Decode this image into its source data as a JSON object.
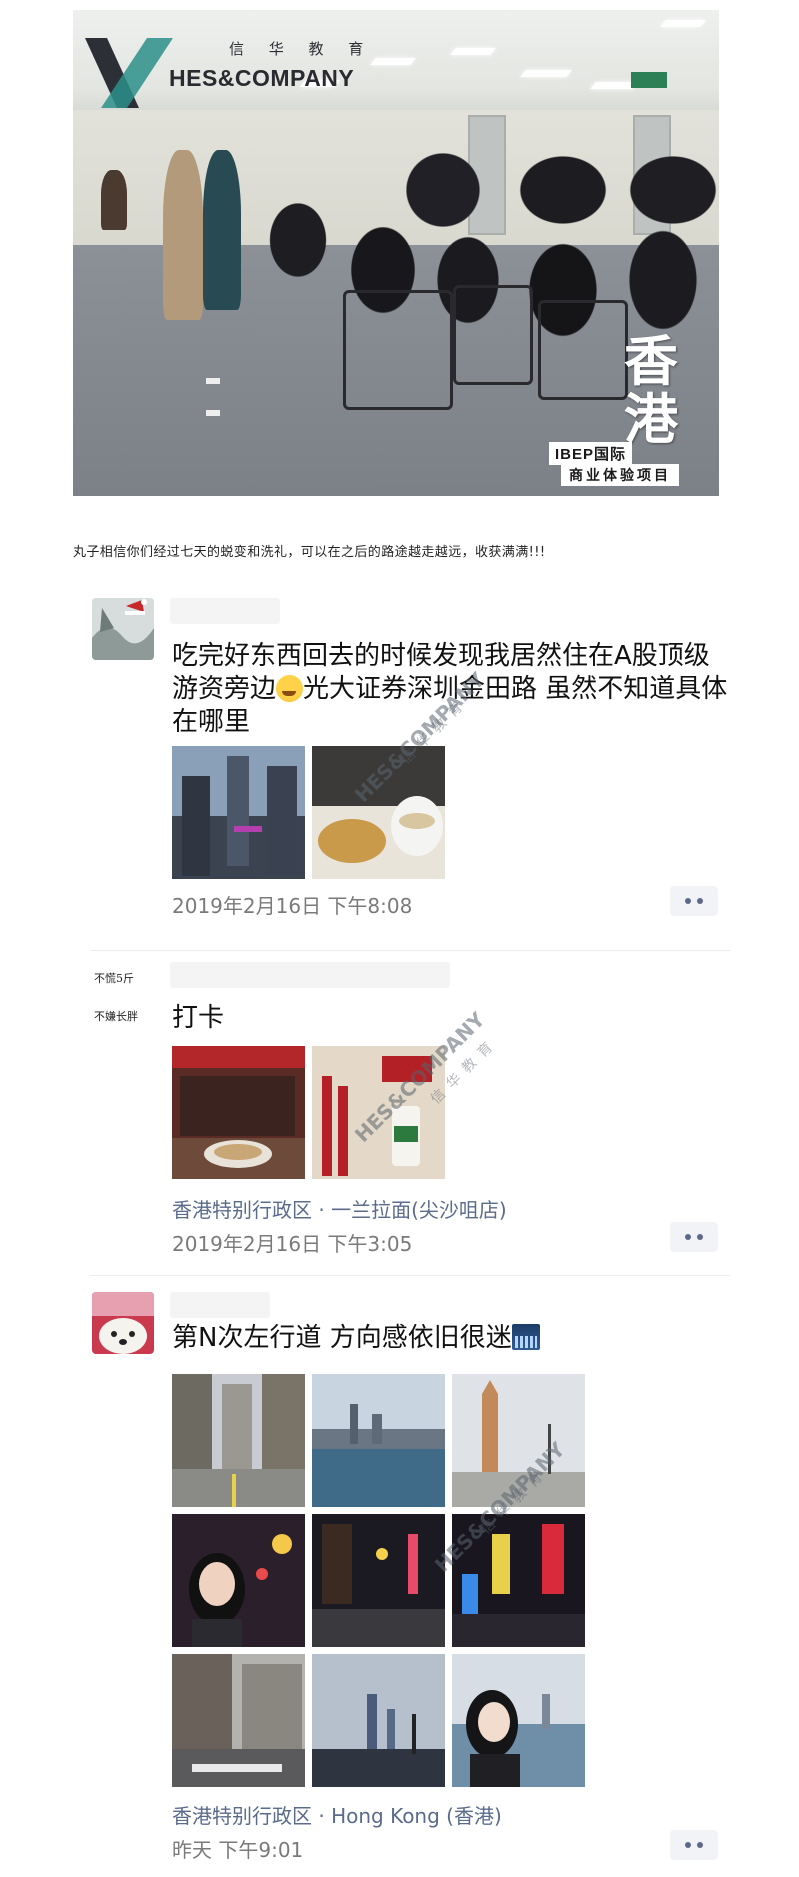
{
  "hero": {
    "logo_cn": "信 华 教 育",
    "logo_en": "HES&COMPANY",
    "seal_big": "香港",
    "seal_tag1": "IBEP国际",
    "seal_tag2": "商业体验项目"
  },
  "caption": "丸子相信你们经过七天的蜕变和洗礼，可以在之后的路途越走越远，收获满满!!!",
  "posts": [
    {
      "text_before_emoji": "吃完好东西回去的时候发现我居然住在A股顶级游资旁边",
      "text_after_emoji": "光大证券深圳金田路 虽然不知道具体在哪里",
      "time": "2019年2月16日 下午8:08"
    },
    {
      "avatar_text_line1": "不慌5斤",
      "avatar_text_line2": "不嫌长胖",
      "text": "打卡",
      "location": "香港特别行政区 · 一兰拉面(尖沙咀店)",
      "time": "2019年2月16日 下午3:05"
    },
    {
      "text": "第N次左行道 方向感依旧很迷",
      "location": "香港特别行政区 · Hong Kong (香港)",
      "time": "昨天 下午9:01"
    }
  ],
  "watermark": {
    "en": "HES&COMPANY",
    "cn": "信华教育"
  }
}
